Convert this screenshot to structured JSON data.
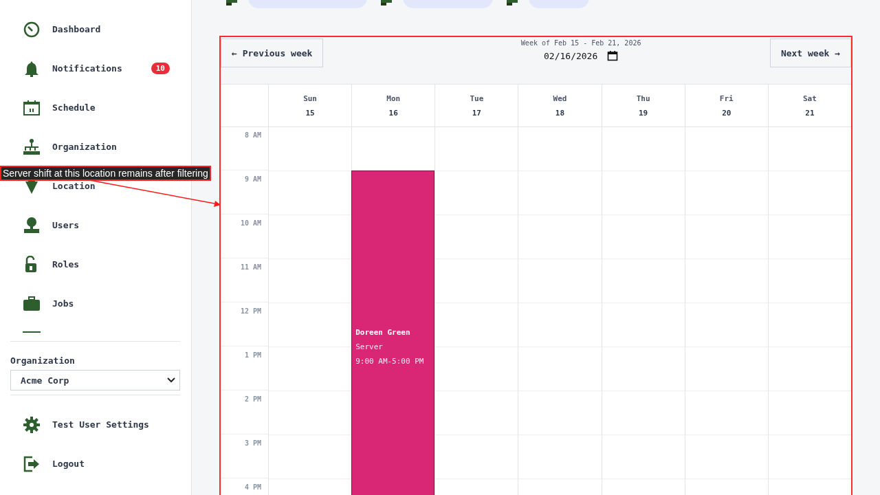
{
  "sidebar": {
    "items": [
      {
        "label": "Dashboard",
        "selected": false
      },
      {
        "label": "Notifications",
        "badge": "10",
        "selected": false
      },
      {
        "label": "Schedule",
        "selected": false
      },
      {
        "label": "Organization",
        "selected": false
      },
      {
        "label": "Location",
        "selected": false
      },
      {
        "label": "Users",
        "selected": false
      },
      {
        "label": "Roles",
        "selected": false
      },
      {
        "label": "Jobs",
        "selected": false
      }
    ],
    "organization": {
      "label": "Organization",
      "value": "Acme Corp"
    },
    "footer_items": [
      {
        "label": "Test User Settings"
      },
      {
        "label": "Logout"
      }
    ]
  },
  "filters": [
    {
      "kind": "chip"
    },
    {
      "kind": "chip"
    },
    {
      "kind": "chip"
    }
  ],
  "calendar": {
    "prev_button": "← Previous week",
    "next_button": "Next week →",
    "week_label": "Week of Feb 15 - Feb 21, 2026",
    "date": "02/16/2026",
    "days": [
      {
        "name": "Sun",
        "date": "15"
      },
      {
        "name": "Mon",
        "date": "16",
        "shifts": [
          {
            "name": "Doreen Green",
            "role": "Server",
            "time": "9:00 AM-5:00 PM",
            "color": "#d92775"
          }
        ]
      },
      {
        "name": "Tue",
        "date": "17"
      },
      {
        "name": "Wed",
        "date": "18"
      },
      {
        "name": "Thu",
        "date": "19"
      },
      {
        "name": "Fri",
        "date": "20"
      },
      {
        "name": "Sat",
        "date": "21"
      }
    ],
    "hours": [
      "8 AM",
      "9 AM",
      "10 AM",
      "11 AM",
      "12 PM",
      "1 PM",
      "2 PM",
      "3 PM",
      "4 PM"
    ]
  },
  "annotation": {
    "text": "Server shift at this location remains after filtering"
  }
}
